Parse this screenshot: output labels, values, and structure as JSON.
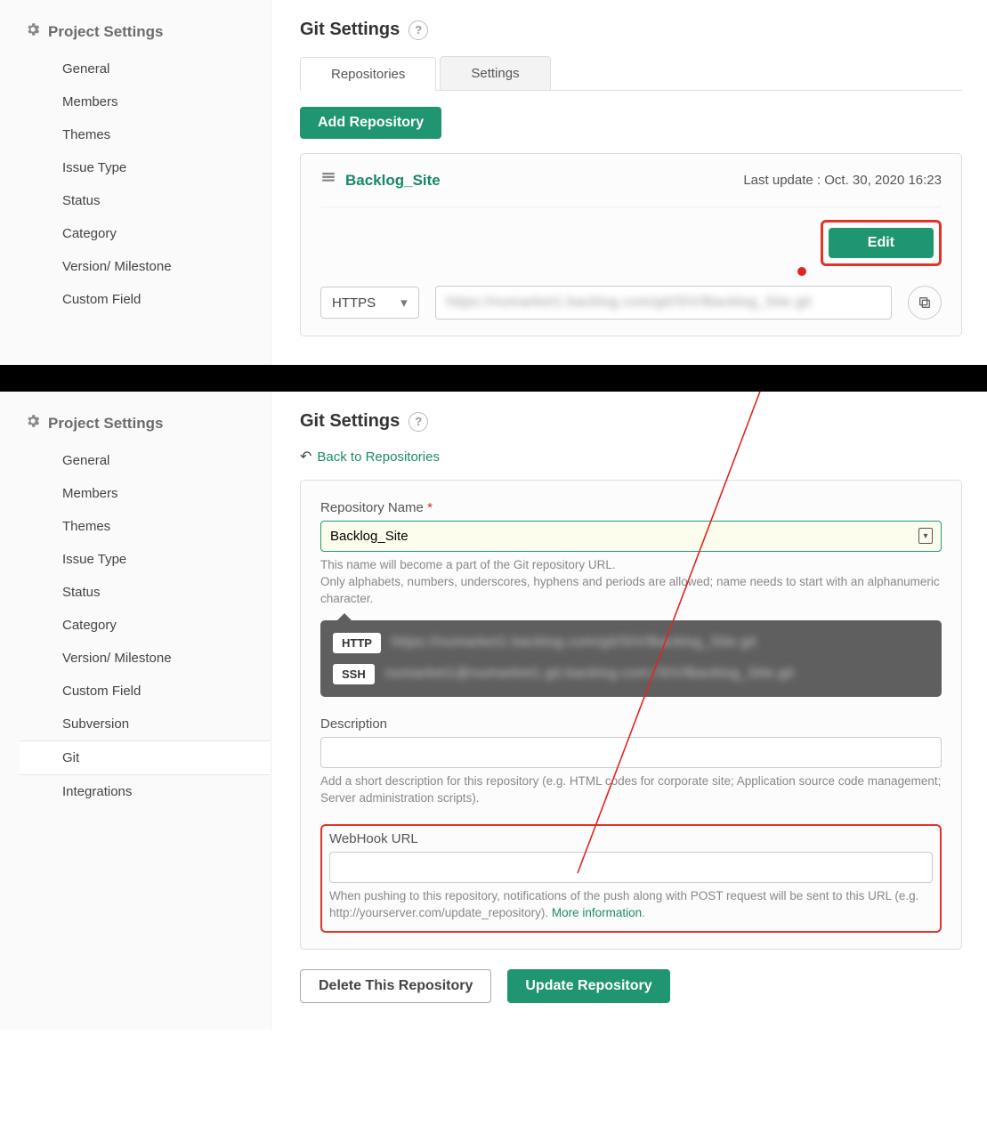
{
  "sidebar_title": "Project Settings",
  "top_nav": [
    "General",
    "Members",
    "Themes",
    "Issue Type",
    "Status",
    "Category",
    "Version/ Milestone",
    "Custom Field"
  ],
  "bottom_nav": [
    "General",
    "Members",
    "Themes",
    "Issue Type",
    "Status",
    "Category",
    "Version/ Milestone",
    "Custom Field",
    "Subversion",
    "Git",
    "Integrations"
  ],
  "bottom_active": "Git",
  "page_title": "Git Settings",
  "tabs": {
    "repos": "Repositories",
    "settings": "Settings"
  },
  "add_repo": "Add Repository",
  "repo": {
    "name": "Backlog_Site",
    "last_update": "Last update : Oct. 30, 2020 16:23",
    "edit": "Edit",
    "protocol": "HTTPS",
    "url_blur": "https://numarket1.backlog.com/git/SIV/Backlog_Site.git"
  },
  "back_link": "Back to Repositories",
  "form": {
    "repo_name_label": "Repository Name",
    "repo_name_value": "Backlog_Site",
    "name_hint1": "This name will become a part of the Git repository URL.",
    "name_hint2": "Only alphabets, numbers, underscores, hyphens and periods are allowed; name needs to start with an alphanumeric character.",
    "http_label": "HTTP",
    "ssh_label": "SSH",
    "http_url": "https://numarket1.backlog.com/git/SIV/Backlog_Site.git",
    "ssh_url": "numarket1@numarket1.git.backlog.com:/SIV/Backlog_Site.git",
    "desc_label": "Description",
    "desc_hint": "Add a short description for this repository (e.g. HTML codes for corporate site; Application source code management; Server administration scripts).",
    "webhook_label": "WebHook URL",
    "webhook_hint_pre": "When pushing to this repository, notifications of the push along with POST request will be sent to this URL (e.g. http://yourserver.com/update_repository). ",
    "webhook_more": "More information",
    "webhook_hint_post": "."
  },
  "delete_btn": "Delete This Repository",
  "update_btn": "Update Repository"
}
